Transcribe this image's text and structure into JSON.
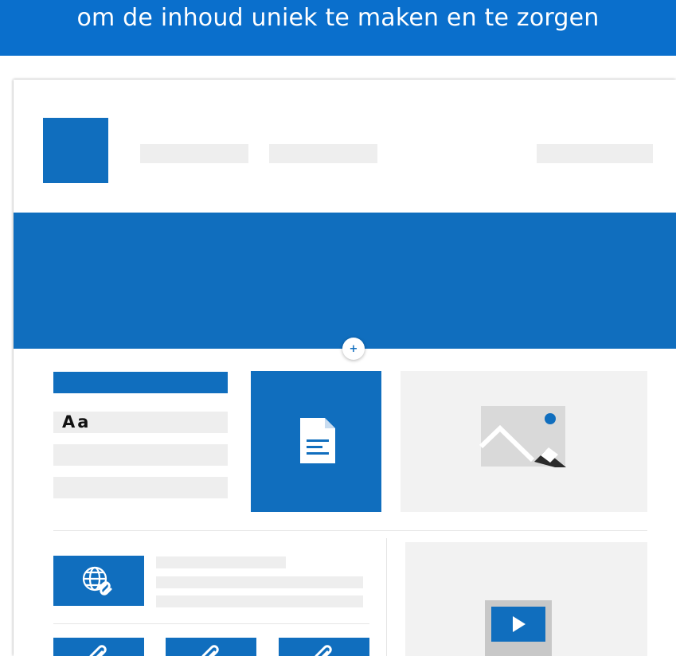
{
  "caption": {
    "line_2": "om de inhoud uniek te maken en te zorgen"
  },
  "text_web_part": {
    "sample_label": "Aa"
  },
  "icons": {
    "add_section": "plus-icon",
    "document": "document-icon",
    "image": "image-icon",
    "globe_link": "globe-link-icon",
    "quick_link": "link-icon",
    "video": "video-play-icon"
  },
  "add_section_button": {
    "symbol": "+"
  },
  "colors": {
    "caption_band": "#0a6fcc",
    "accent_blue": "#106ebe",
    "placeholder_gray": "#eeeeee",
    "tile_gray": "#f2f2f2",
    "image_icon_gray": "#d9d9d9",
    "image_icon_dark": "#2b2b2b"
  }
}
